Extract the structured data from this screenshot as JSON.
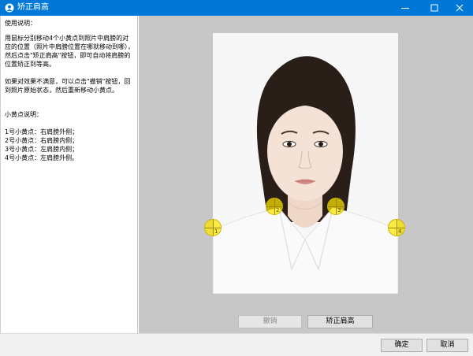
{
  "window": {
    "title": "矫正肩高",
    "icon": "app-icon",
    "controls": [
      "minimize-icon",
      "maximize-icon",
      "close-icon"
    ]
  },
  "instructions": {
    "heading": "使用说明：",
    "paragraph1": "用鼠标分别移动4个小黄点到照片中肩膀的对应的位置（照片中肩膀位置在哪就移动到哪），然后点击\"矫正肩高\"按钮，即可自动将肩膀的位置矫正到等高。",
    "paragraph2": "如果对效果不满意，可以点击\"撤销\"按钮，回到照片原始状态，然后重新移动小黄点。",
    "dots_heading": "小黄点说明：",
    "dots": [
      "1号小黄点：右肩膀外侧；",
      "2号小黄点：右肩膀内侧；",
      "3号小黄点：左肩膀内侧；",
      "4号小黄点：左肩膀外侧。"
    ]
  },
  "markers": [
    {
      "label": "1"
    },
    {
      "label": "2"
    },
    {
      "label": "3"
    },
    {
      "label": "4"
    }
  ],
  "actions": {
    "undo": "撤销",
    "correct": "矫正肩高"
  },
  "footer": {
    "ok": "确定",
    "cancel": "取消"
  },
  "colors": {
    "titlebar": "#0078d7",
    "marker_fill": "#ffe600",
    "canvas_bg": "#c7c7c7"
  }
}
